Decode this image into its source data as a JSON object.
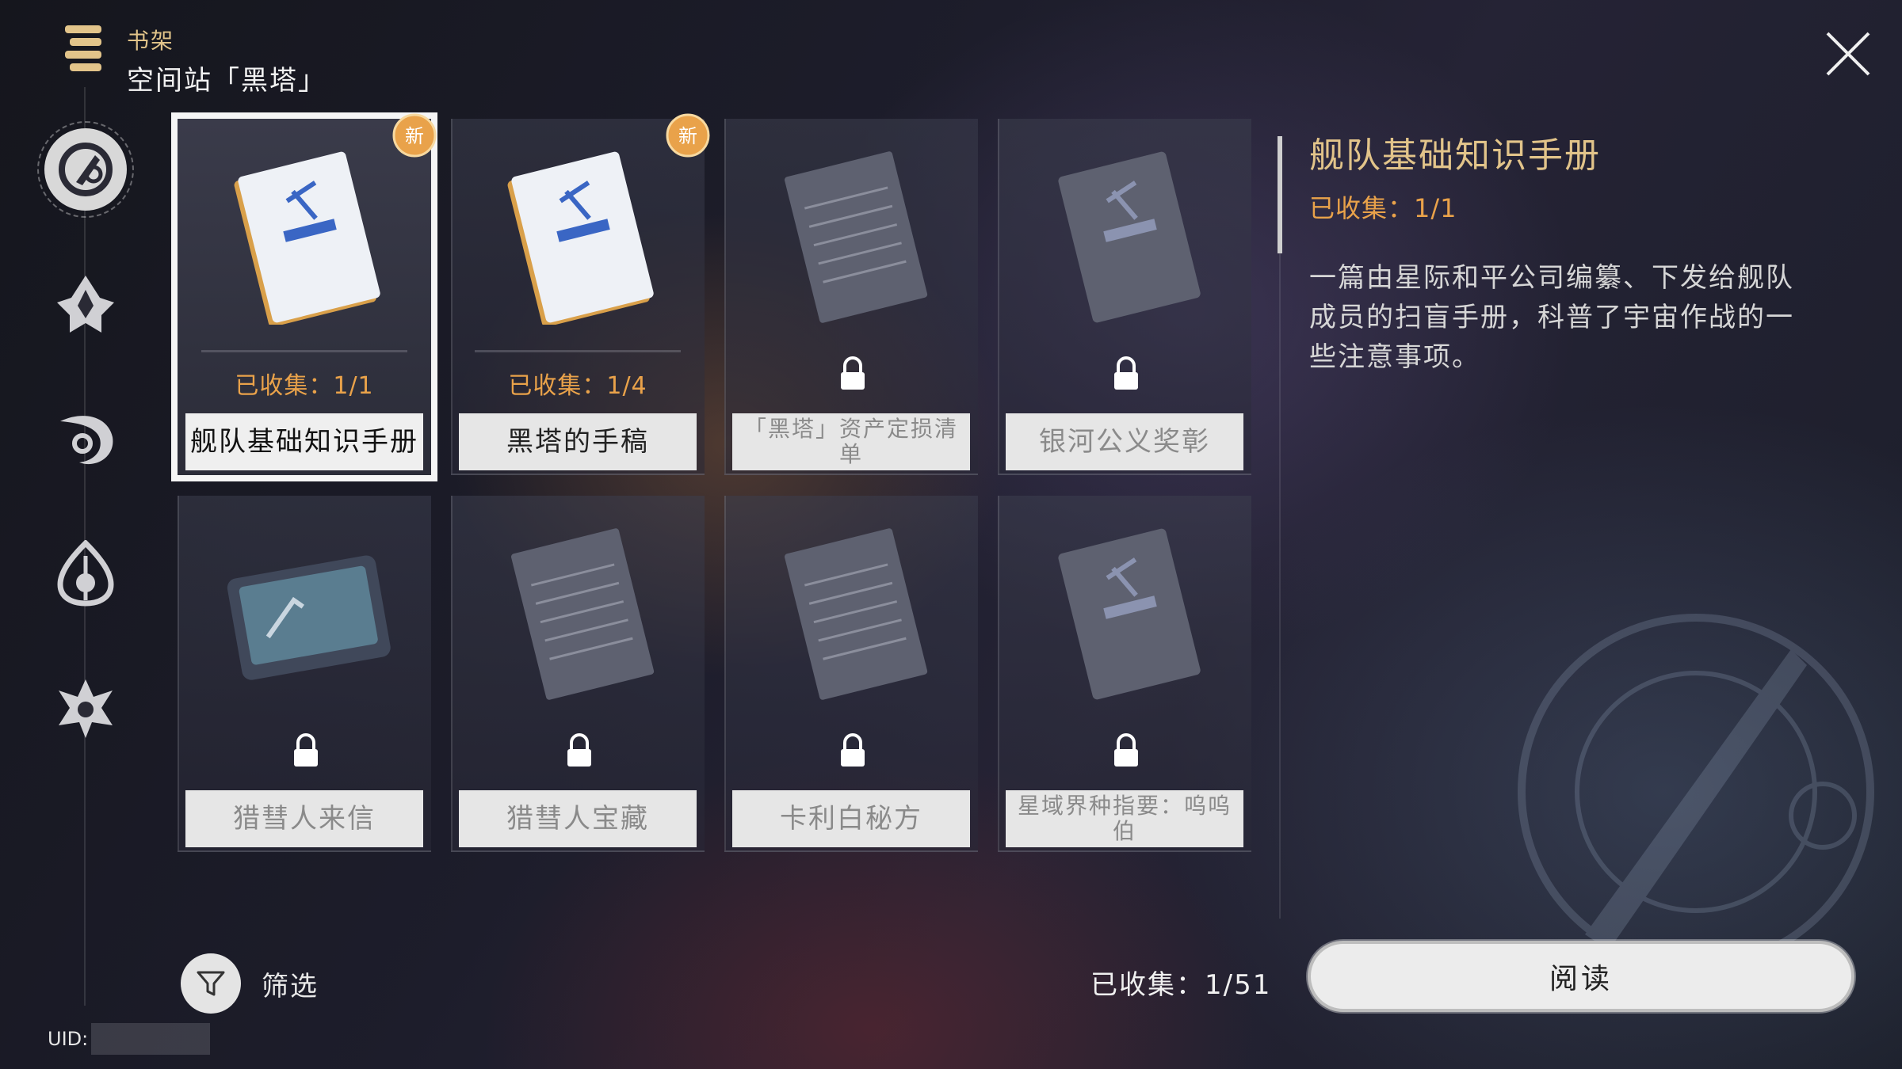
{
  "header": {
    "breadcrumb": "书架",
    "title": "空间站「黑塔」"
  },
  "side_nav": {
    "items": [
      {
        "icon": "space-station-icon",
        "active": true
      },
      {
        "icon": "jarilo-icon",
        "active": false
      },
      {
        "icon": "xianzhou-icon",
        "active": false
      },
      {
        "icon": "penacony-icon",
        "active": false
      },
      {
        "icon": "other-world-icon",
        "active": false
      }
    ]
  },
  "books": [
    {
      "title": "舰队基础知识手册",
      "collected": "已收集：1/1",
      "unlocked": true,
      "selected": true,
      "new_badge": "新",
      "art": "manual"
    },
    {
      "title": "黑塔的手稿",
      "collected": "已收集：1/4",
      "unlocked": true,
      "selected": false,
      "new_badge": "新",
      "art": "manual"
    },
    {
      "title": "「黑塔」资产定损清单",
      "unlocked": false,
      "art": "notes"
    },
    {
      "title": "银河公义奖彰",
      "unlocked": false,
      "art": "manual"
    },
    {
      "title": "猎彗人来信",
      "unlocked": false,
      "art": "tablet"
    },
    {
      "title": "猎彗人宝藏",
      "unlocked": false,
      "art": "notes"
    },
    {
      "title": "卡利白秘方",
      "unlocked": false,
      "art": "notes"
    },
    {
      "title": "星域界种指要：呜呜伯",
      "unlocked": false,
      "art": "manual"
    }
  ],
  "detail": {
    "title": "舰队基础知识手册",
    "collected": "已收集：1/1",
    "description": "一篇由星际和平公司编纂、下发给舰队成员的扫盲手册，科普了宇宙作战的一些注意事项。"
  },
  "filter": {
    "label": "筛选"
  },
  "total_collected": "已收集：1/51",
  "read_button": "阅读",
  "uid": {
    "label": "UID:"
  },
  "colors": {
    "accent_gold": "#e2c48a",
    "collected_orange": "#e9a24a",
    "selection": "#f5f5f5"
  }
}
